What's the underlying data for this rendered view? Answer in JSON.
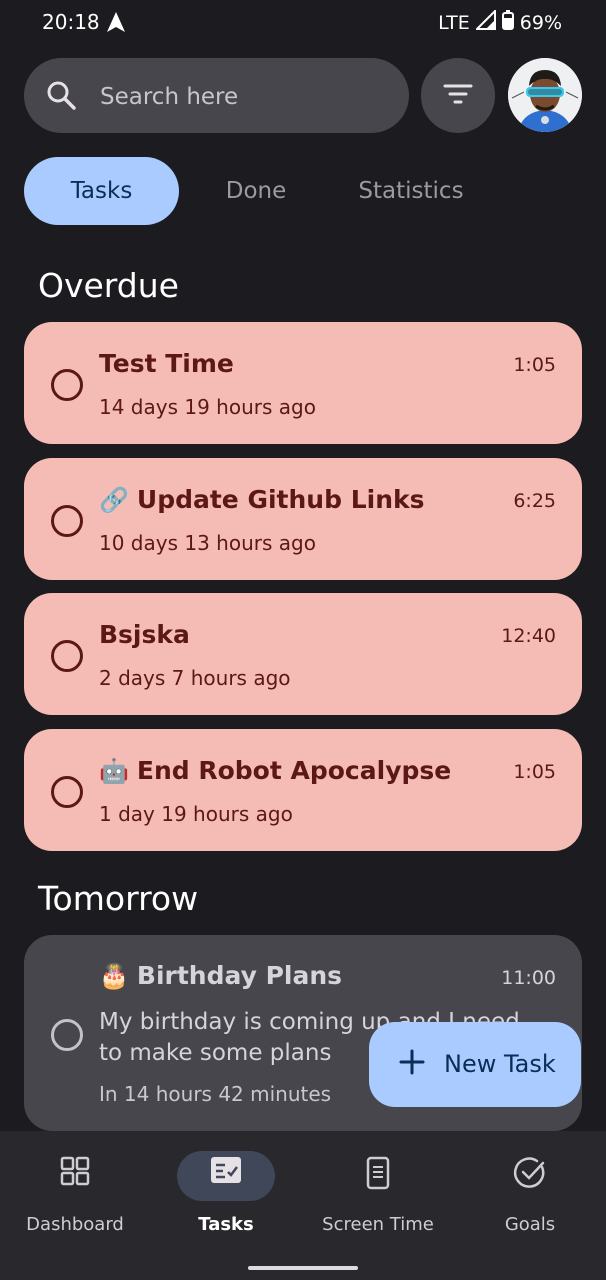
{
  "status_bar": {
    "time": "20:18",
    "network": "LTE",
    "battery": "69%"
  },
  "search": {
    "placeholder": "Search here"
  },
  "tabs": [
    {
      "label": "Tasks",
      "active": true
    },
    {
      "label": "Done",
      "active": false
    },
    {
      "label": "Statistics",
      "active": false
    }
  ],
  "sections": {
    "overdue": {
      "title": "Overdue",
      "tasks": [
        {
          "emoji": "",
          "title": "Test Time",
          "time": "1:05",
          "relative": "14 days 19 hours ago"
        },
        {
          "emoji": "🔗",
          "title": "Update Github Links",
          "time": "6:25",
          "relative": "10 days 13 hours ago"
        },
        {
          "emoji": "",
          "title": "Bsjska",
          "time": "12:40",
          "relative": "2 days 7 hours ago"
        },
        {
          "emoji": "🤖",
          "title": "End Robot Apocalypse",
          "time": "1:05",
          "relative": "1 day 19 hours ago"
        }
      ]
    },
    "tomorrow": {
      "title": "Tomorrow",
      "tasks": [
        {
          "emoji": "🎂",
          "title": "Birthday Plans",
          "time": "11:00",
          "description": "My birthday is coming up and I need to make some plans",
          "relative": "In 14 hours 42 minutes"
        }
      ]
    }
  },
  "fab": {
    "label": "New Task"
  },
  "bottom_nav": [
    {
      "label": "Dashboard",
      "icon": "grid-icon",
      "active": false
    },
    {
      "label": "Tasks",
      "icon": "task-list-icon",
      "active": true
    },
    {
      "label": "Screen Time",
      "icon": "phone-icon",
      "active": false
    },
    {
      "label": "Goals",
      "icon": "check-circle-icon",
      "active": false
    }
  ],
  "colors": {
    "background": "#1c1b1f",
    "overdue_card": "#f5bcb6",
    "overdue_text": "#5c1816",
    "accent": "#a9cbff",
    "surface": "#47464c"
  }
}
